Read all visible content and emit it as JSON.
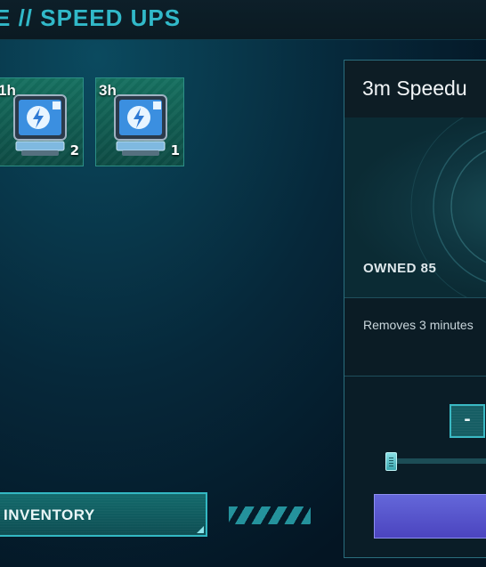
{
  "header": {
    "title": "E // SPEED UPS"
  },
  "items": [
    {
      "duration": "1h",
      "count": "2"
    },
    {
      "duration": "3h",
      "count": "1"
    }
  ],
  "footer": {
    "inventory_label": "INVENTORY"
  },
  "detail": {
    "title": "3m Speedu",
    "owned_label": "OWNED 85",
    "description": "Removes 3 minutes",
    "minus_label": "-",
    "quantity_fraction": 0.0
  },
  "colors": {
    "accent": "#31b9c9",
    "use_button": "#5a57cf"
  }
}
